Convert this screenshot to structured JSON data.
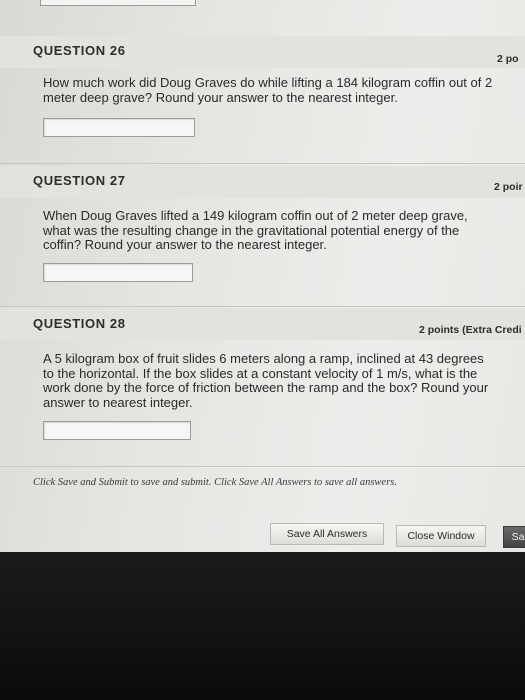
{
  "questions": [
    {
      "title": "QUESTION 26",
      "points": "2 po",
      "text": "How much work did Doug Graves do while lifting a 184 kilogram coffin out of 2 meter deep grave? Round your answer to the nearest integer.",
      "answer": ""
    },
    {
      "title": "QUESTION 27",
      "points": "2 poir",
      "text": "When Doug Graves lifted a 149 kilogram coffin out of 2 meter deep grave, what was the resulting change in the gravitational potential energy of the coffin? Round your answer to the nearest integer.",
      "answer": ""
    },
    {
      "title": "QUESTION 28",
      "points": "2 points (Extra Credi",
      "text": "A 5 kilogram box of fruit slides 6 meters along a ramp, inclined at 43 degrees to the horizontal. If the box slides at a constant velocity of 1 m/s, what is the work done by the force of friction between the ramp and the box? Round your answer to nearest integer.",
      "answer": ""
    }
  ],
  "footer": {
    "note": "Click Save and Submit to save and submit. Click Save All Answers to save all answers.",
    "save_all_label": "Save All Answers",
    "close_window_label": "Close Window",
    "save_submit_label": "Sa"
  }
}
